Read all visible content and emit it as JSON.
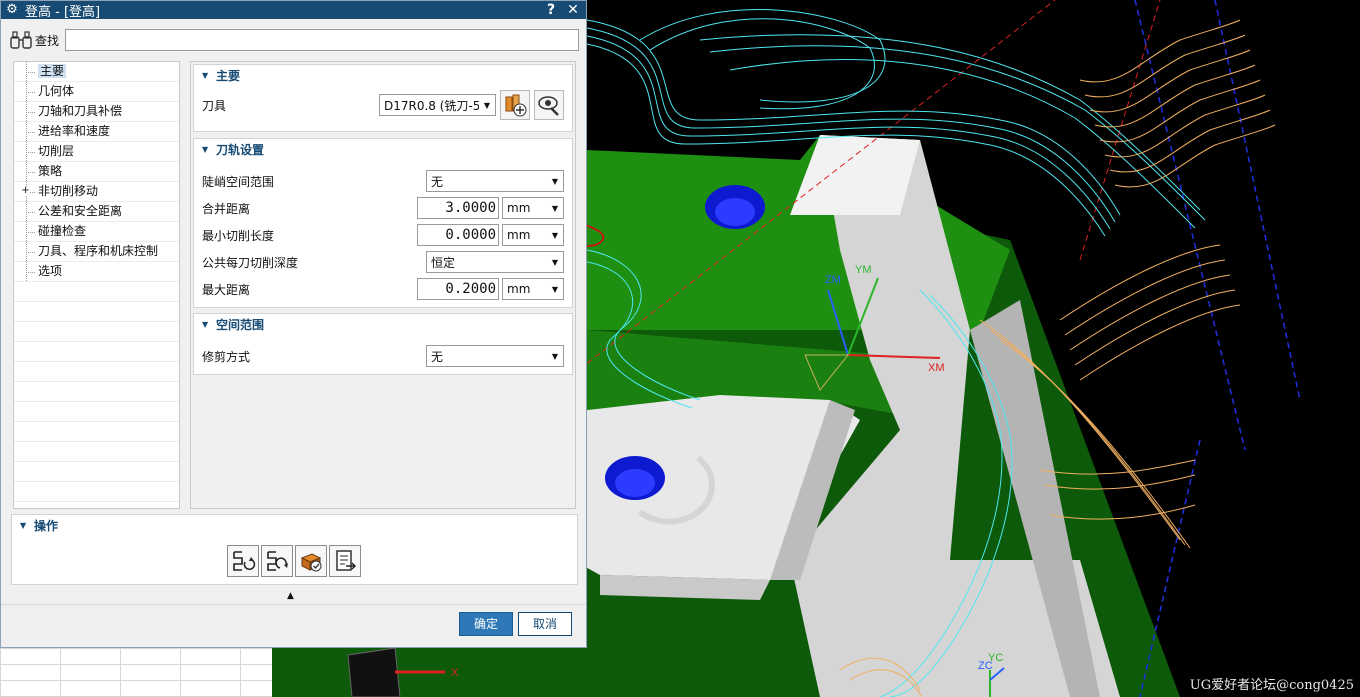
{
  "window": {
    "title": "登高 - [登高]",
    "help_label": "?",
    "close_label": "✕"
  },
  "find": {
    "label": "查找",
    "value": ""
  },
  "tree": {
    "items": [
      {
        "label": "主要",
        "selected": true,
        "expandable": false
      },
      {
        "label": "几何体",
        "expandable": false
      },
      {
        "label": "刀轴和刀具补偿",
        "expandable": false
      },
      {
        "label": "进给率和速度",
        "expandable": false
      },
      {
        "label": "切削层",
        "expandable": false
      },
      {
        "label": "策略",
        "expandable": false
      },
      {
        "label": "非切削移动",
        "expandable": true
      },
      {
        "label": "公差和安全距离",
        "expandable": false
      },
      {
        "label": "碰撞检查",
        "expandable": false
      },
      {
        "label": "刀具、程序和机床控制",
        "expandable": false
      },
      {
        "label": "选项",
        "expandable": false
      }
    ],
    "expand_symbol": "+"
  },
  "main_group": {
    "title": "主要",
    "tool_label": "刀具",
    "tool_value": "D17R0.8 (铣刀-5"
  },
  "path_group": {
    "title": "刀轨设置",
    "steep_label": "陡峭空间范围",
    "steep_value": "无",
    "merge_label": "合并距离",
    "merge_value": "3.0000",
    "merge_unit": "mm",
    "min_cut_label": "最小切削长度",
    "min_cut_value": "0.0000",
    "min_cut_unit": "mm",
    "depth_label": "公共每刀切削深度",
    "depth_value": "恒定",
    "max_dist_label": "最大距离",
    "max_dist_value": "0.2000",
    "max_dist_unit": "mm"
  },
  "space_group": {
    "title": "空间范围",
    "trim_label": "修剪方式",
    "trim_value": "无"
  },
  "ops_group": {
    "title": "操作"
  },
  "buttons": {
    "ok": "确定",
    "cancel": "取消"
  },
  "viewport": {
    "axis_zm": "ZM",
    "axis_ym": "YM",
    "axis_xm": "XM",
    "axis_x": "X",
    "axis_zc": "ZC",
    "axis_yc": "YC",
    "watermark": "UG爱好者论坛@cong0425"
  },
  "colors": {
    "title_bar": "#174b74",
    "ok_button": "#2e78b7",
    "annotation": "#d01010",
    "toolpath_cyan": "#4fe6f0",
    "toolpath_orange": "#f0b060",
    "plate_green": "#1f8f12"
  }
}
